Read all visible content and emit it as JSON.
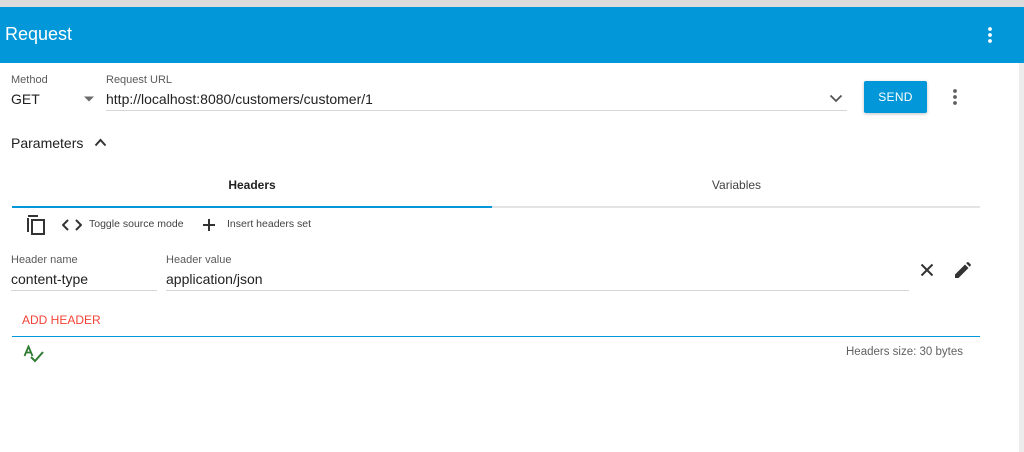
{
  "app": {
    "title": "Request"
  },
  "request": {
    "method_label": "Method",
    "method_value": "GET",
    "url_label": "Request URL",
    "url_value": "http://localhost:8080/customers/customer/1",
    "send_label": "SEND"
  },
  "parameters": {
    "title": "Parameters"
  },
  "tabs": [
    {
      "label": "Headers",
      "active": true
    },
    {
      "label": "Variables",
      "active": false
    }
  ],
  "toolbar": {
    "toggle_source_label": "Toggle source mode",
    "insert_headers_label": "Insert headers set"
  },
  "header_row": {
    "name_label": "Header name",
    "name_value": "content-type",
    "value_label": "Header value",
    "value_value": "application/json"
  },
  "add_header_label": "ADD HEADER",
  "headers_size_text": "Headers size: 30 bytes",
  "icons": {
    "appbar_menu": "more-vert-icon",
    "method_dropdown": "arrow-drop-down-icon",
    "url_dropdown": "chevron-down-icon",
    "request_menu": "more-vert-icon",
    "parameters_toggle": "chevron-up-icon",
    "copy": "copy-icon",
    "code": "code-icon",
    "add": "plus-icon",
    "remove_header": "close-icon",
    "edit_header": "pencil-icon",
    "spellcheck": "spellcheck-icon"
  },
  "colors": {
    "primary": "#0197d8",
    "accent_red": "#f44336",
    "check_green": "#2e7d32"
  }
}
